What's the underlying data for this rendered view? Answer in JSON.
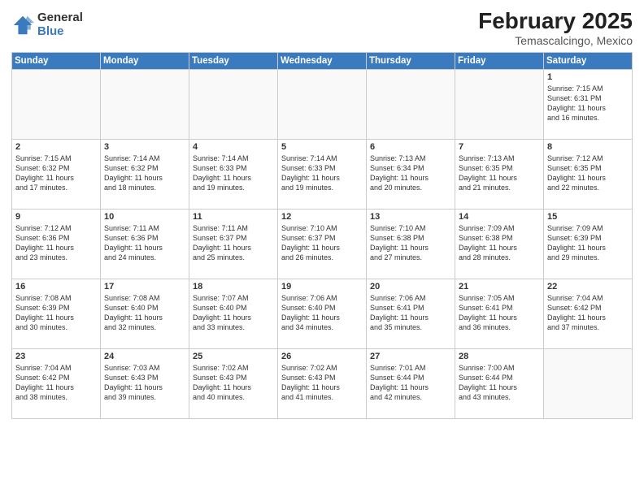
{
  "header": {
    "logo_general": "General",
    "logo_blue": "Blue",
    "month_title": "February 2025",
    "location": "Temascalcingo, Mexico"
  },
  "weekdays": [
    "Sunday",
    "Monday",
    "Tuesday",
    "Wednesday",
    "Thursday",
    "Friday",
    "Saturday"
  ],
  "weeks": [
    [
      {
        "day": "",
        "info": ""
      },
      {
        "day": "",
        "info": ""
      },
      {
        "day": "",
        "info": ""
      },
      {
        "day": "",
        "info": ""
      },
      {
        "day": "",
        "info": ""
      },
      {
        "day": "",
        "info": ""
      },
      {
        "day": "1",
        "info": "Sunrise: 7:15 AM\nSunset: 6:31 PM\nDaylight: 11 hours\nand 16 minutes."
      }
    ],
    [
      {
        "day": "2",
        "info": "Sunrise: 7:15 AM\nSunset: 6:32 PM\nDaylight: 11 hours\nand 17 minutes."
      },
      {
        "day": "3",
        "info": "Sunrise: 7:14 AM\nSunset: 6:32 PM\nDaylight: 11 hours\nand 18 minutes."
      },
      {
        "day": "4",
        "info": "Sunrise: 7:14 AM\nSunset: 6:33 PM\nDaylight: 11 hours\nand 19 minutes."
      },
      {
        "day": "5",
        "info": "Sunrise: 7:14 AM\nSunset: 6:33 PM\nDaylight: 11 hours\nand 19 minutes."
      },
      {
        "day": "6",
        "info": "Sunrise: 7:13 AM\nSunset: 6:34 PM\nDaylight: 11 hours\nand 20 minutes."
      },
      {
        "day": "7",
        "info": "Sunrise: 7:13 AM\nSunset: 6:35 PM\nDaylight: 11 hours\nand 21 minutes."
      },
      {
        "day": "8",
        "info": "Sunrise: 7:12 AM\nSunset: 6:35 PM\nDaylight: 11 hours\nand 22 minutes."
      }
    ],
    [
      {
        "day": "9",
        "info": "Sunrise: 7:12 AM\nSunset: 6:36 PM\nDaylight: 11 hours\nand 23 minutes."
      },
      {
        "day": "10",
        "info": "Sunrise: 7:11 AM\nSunset: 6:36 PM\nDaylight: 11 hours\nand 24 minutes."
      },
      {
        "day": "11",
        "info": "Sunrise: 7:11 AM\nSunset: 6:37 PM\nDaylight: 11 hours\nand 25 minutes."
      },
      {
        "day": "12",
        "info": "Sunrise: 7:10 AM\nSunset: 6:37 PM\nDaylight: 11 hours\nand 26 minutes."
      },
      {
        "day": "13",
        "info": "Sunrise: 7:10 AM\nSunset: 6:38 PM\nDaylight: 11 hours\nand 27 minutes."
      },
      {
        "day": "14",
        "info": "Sunrise: 7:09 AM\nSunset: 6:38 PM\nDaylight: 11 hours\nand 28 minutes."
      },
      {
        "day": "15",
        "info": "Sunrise: 7:09 AM\nSunset: 6:39 PM\nDaylight: 11 hours\nand 29 minutes."
      }
    ],
    [
      {
        "day": "16",
        "info": "Sunrise: 7:08 AM\nSunset: 6:39 PM\nDaylight: 11 hours\nand 30 minutes."
      },
      {
        "day": "17",
        "info": "Sunrise: 7:08 AM\nSunset: 6:40 PM\nDaylight: 11 hours\nand 32 minutes."
      },
      {
        "day": "18",
        "info": "Sunrise: 7:07 AM\nSunset: 6:40 PM\nDaylight: 11 hours\nand 33 minutes."
      },
      {
        "day": "19",
        "info": "Sunrise: 7:06 AM\nSunset: 6:40 PM\nDaylight: 11 hours\nand 34 minutes."
      },
      {
        "day": "20",
        "info": "Sunrise: 7:06 AM\nSunset: 6:41 PM\nDaylight: 11 hours\nand 35 minutes."
      },
      {
        "day": "21",
        "info": "Sunrise: 7:05 AM\nSunset: 6:41 PM\nDaylight: 11 hours\nand 36 minutes."
      },
      {
        "day": "22",
        "info": "Sunrise: 7:04 AM\nSunset: 6:42 PM\nDaylight: 11 hours\nand 37 minutes."
      }
    ],
    [
      {
        "day": "23",
        "info": "Sunrise: 7:04 AM\nSunset: 6:42 PM\nDaylight: 11 hours\nand 38 minutes."
      },
      {
        "day": "24",
        "info": "Sunrise: 7:03 AM\nSunset: 6:43 PM\nDaylight: 11 hours\nand 39 minutes."
      },
      {
        "day": "25",
        "info": "Sunrise: 7:02 AM\nSunset: 6:43 PM\nDaylight: 11 hours\nand 40 minutes."
      },
      {
        "day": "26",
        "info": "Sunrise: 7:02 AM\nSunset: 6:43 PM\nDaylight: 11 hours\nand 41 minutes."
      },
      {
        "day": "27",
        "info": "Sunrise: 7:01 AM\nSunset: 6:44 PM\nDaylight: 11 hours\nand 42 minutes."
      },
      {
        "day": "28",
        "info": "Sunrise: 7:00 AM\nSunset: 6:44 PM\nDaylight: 11 hours\nand 43 minutes."
      },
      {
        "day": "",
        "info": ""
      }
    ]
  ]
}
